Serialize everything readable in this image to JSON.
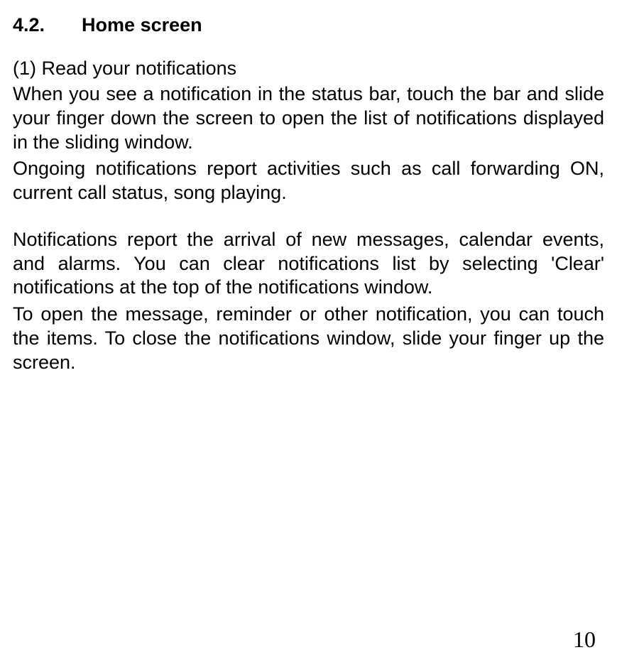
{
  "section": {
    "number": "4.2.",
    "title": "Home screen"
  },
  "subsection": {
    "heading": "(1) Read your notifications"
  },
  "paragraphs": {
    "p1": "When you see a notification in the status bar, touch the bar and slide your finger down the screen to open the list of notifications displayed in the sliding window.",
    "p2": "Ongoing notifications report activities such as call forwarding ON, current call status, song playing.",
    "p3": "Notifications report the arrival of new messages, calendar events, and alarms. You can clear notifications list by selecting 'Clear' notifications at the top of the notifications window.",
    "p4": "To open the message, reminder or other notification, you can touch the items. To close the notifications window, slide your finger up the screen."
  },
  "pageNumber": "10"
}
